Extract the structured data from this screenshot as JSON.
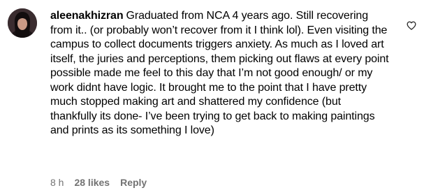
{
  "comment": {
    "username": "aleenakhizran",
    "text": "Graduated from NCA 4 years ago. Still recovering from it.. (or probably won’t recover from it I think lol). Even visiting the campus to collect documents triggers anxiety. As much as I loved art itself, the juries and perceptions, them picking out flaws at every point possible made me feel to this day that I’m not good enough/ or my work didnt have logic. It brought me to the point that I have pretty much stopped making art and shattered my confidence (but thankfully its done- I’ve been trying to get back to making paintings and prints as its something I love)",
    "time": "8 h",
    "likes": "28 likes",
    "reply_label": "Reply",
    "like_icon": "heart-outline-icon"
  }
}
